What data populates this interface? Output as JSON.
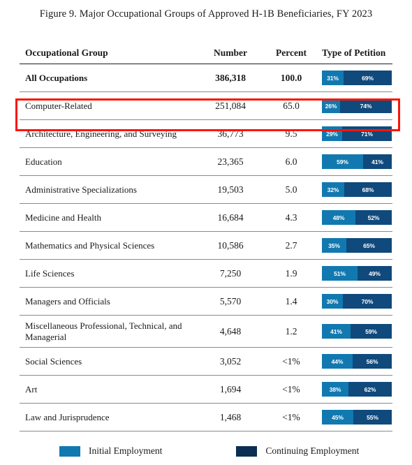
{
  "figure": {
    "title": "Figure 9. Major Occupational Groups of Approved H-1B Beneficiaries, FY 2023"
  },
  "table": {
    "columns": {
      "group": "Occupational Group",
      "number": "Number",
      "percent": "Percent",
      "petition": "Type of Petition"
    },
    "rows": [
      {
        "group": "All Occupations",
        "number": "386,318",
        "percent": "100.0",
        "initial_label": "31%",
        "continuing_label": "69%",
        "initial_pct": 31,
        "continuing_pct": 69,
        "emphasis": "total",
        "highlighted": false
      },
      {
        "group": "Computer-Related",
        "number": "251,084",
        "percent": "65.0",
        "initial_label": "26%",
        "continuing_label": "74%",
        "initial_pct": 26,
        "continuing_pct": 74,
        "emphasis": "normal",
        "highlighted": true
      },
      {
        "group": "Architecture, Engineering, and Surveying",
        "number": "36,773",
        "percent": "9.5",
        "initial_label": "29%",
        "continuing_label": "71%",
        "initial_pct": 29,
        "continuing_pct": 71,
        "emphasis": "normal",
        "highlighted": false
      },
      {
        "group": "Education",
        "number": "23,365",
        "percent": "6.0",
        "initial_label": "59%",
        "continuing_label": "41%",
        "initial_pct": 59,
        "continuing_pct": 41,
        "emphasis": "normal",
        "highlighted": false
      },
      {
        "group": "Administrative Specializations",
        "number": "19,503",
        "percent": "5.0",
        "initial_label": "32%",
        "continuing_label": "68%",
        "initial_pct": 32,
        "continuing_pct": 68,
        "emphasis": "normal",
        "highlighted": false
      },
      {
        "group": "Medicine and Health",
        "number": "16,684",
        "percent": "4.3",
        "initial_label": "48%",
        "continuing_label": "52%",
        "initial_pct": 48,
        "continuing_pct": 52,
        "emphasis": "normal",
        "highlighted": false
      },
      {
        "group": "Mathematics and Physical Sciences",
        "number": "10,586",
        "percent": "2.7",
        "initial_label": "35%",
        "continuing_label": "65%",
        "initial_pct": 35,
        "continuing_pct": 65,
        "emphasis": "normal",
        "highlighted": false
      },
      {
        "group": "Life Sciences",
        "number": "7,250",
        "percent": "1.9",
        "initial_label": "51%",
        "continuing_label": "49%",
        "initial_pct": 51,
        "continuing_pct": 49,
        "emphasis": "normal",
        "highlighted": false
      },
      {
        "group": "Managers and Officials",
        "number": "5,570",
        "percent": "1.4",
        "initial_label": "30%",
        "continuing_label": "70%",
        "initial_pct": 30,
        "continuing_pct": 70,
        "emphasis": "normal",
        "highlighted": false
      },
      {
        "group": "Miscellaneous Professional, Technical, and Managerial",
        "number": "4,648",
        "percent": "1.2",
        "initial_label": "41%",
        "continuing_label": "59%",
        "initial_pct": 41,
        "continuing_pct": 59,
        "emphasis": "normal",
        "highlighted": false
      },
      {
        "group": "Social Sciences",
        "number": "3,052",
        "percent": "<1%",
        "initial_label": "44%",
        "continuing_label": "56%",
        "initial_pct": 44,
        "continuing_pct": 56,
        "emphasis": "normal",
        "highlighted": false
      },
      {
        "group": "Art",
        "number": "1,694",
        "percent": "<1%",
        "initial_label": "38%",
        "continuing_label": "62%",
        "initial_pct": 38,
        "continuing_pct": 62,
        "emphasis": "normal",
        "highlighted": false
      },
      {
        "group": "Law and Jurisprudence",
        "number": "1,468",
        "percent": "<1%",
        "initial_label": "45%",
        "continuing_label": "55%",
        "initial_pct": 45,
        "continuing_pct": 55,
        "emphasis": "normal",
        "highlighted": false
      }
    ]
  },
  "legend": {
    "items": [
      {
        "label": "Initial Employment",
        "color": "#1179b0"
      },
      {
        "label": "Continuing Employment",
        "color": "#0b2e52"
      }
    ]
  },
  "colors": {
    "initial": "#1179b0",
    "continuing": "#10497c",
    "continuing_legend": "#0b2e52",
    "highlight": "#fc1505",
    "rule": "#8a8a8a",
    "header_rule": "#1d1d1d"
  },
  "chart_data": {
    "type": "bar",
    "title": "Figure 9. Major Occupational Groups of Approved H-1B Beneficiaries, FY 2023",
    "orientation": "horizontal-stacked-100",
    "categories": [
      "All Occupations",
      "Computer-Related",
      "Architecture, Engineering, and Surveying",
      "Education",
      "Administrative Specializations",
      "Medicine and Health",
      "Mathematics and Physical Sciences",
      "Life Sciences",
      "Managers and Officials",
      "Miscellaneous Professional, Technical, and Managerial",
      "Social Sciences",
      "Art",
      "Law and Jurisprudence"
    ],
    "series": [
      {
        "name": "Initial Employment",
        "color": "#1179b0",
        "values": [
          31,
          26,
          29,
          59,
          32,
          48,
          35,
          51,
          30,
          41,
          44,
          38,
          45
        ]
      },
      {
        "name": "Continuing Employment",
        "color": "#0b2e52",
        "values": [
          69,
          74,
          71,
          41,
          68,
          52,
          65,
          49,
          70,
          59,
          56,
          62,
          55
        ]
      }
    ],
    "number_column": [
      386318,
      251084,
      36773,
      23365,
      19503,
      16684,
      10586,
      7250,
      5570,
      4648,
      3052,
      1694,
      1468
    ],
    "percent_column": [
      "100.0",
      "65.0",
      "9.5",
      "6.0",
      "5.0",
      "4.3",
      "2.7",
      "1.9",
      "1.4",
      "1.2",
      "<1%",
      "<1%",
      "<1%"
    ],
    "xlabel": "",
    "ylabel": "",
    "xlim": [
      0,
      100
    ],
    "grid": false,
    "legend_position": "bottom",
    "highlighted_category": "Computer-Related"
  }
}
